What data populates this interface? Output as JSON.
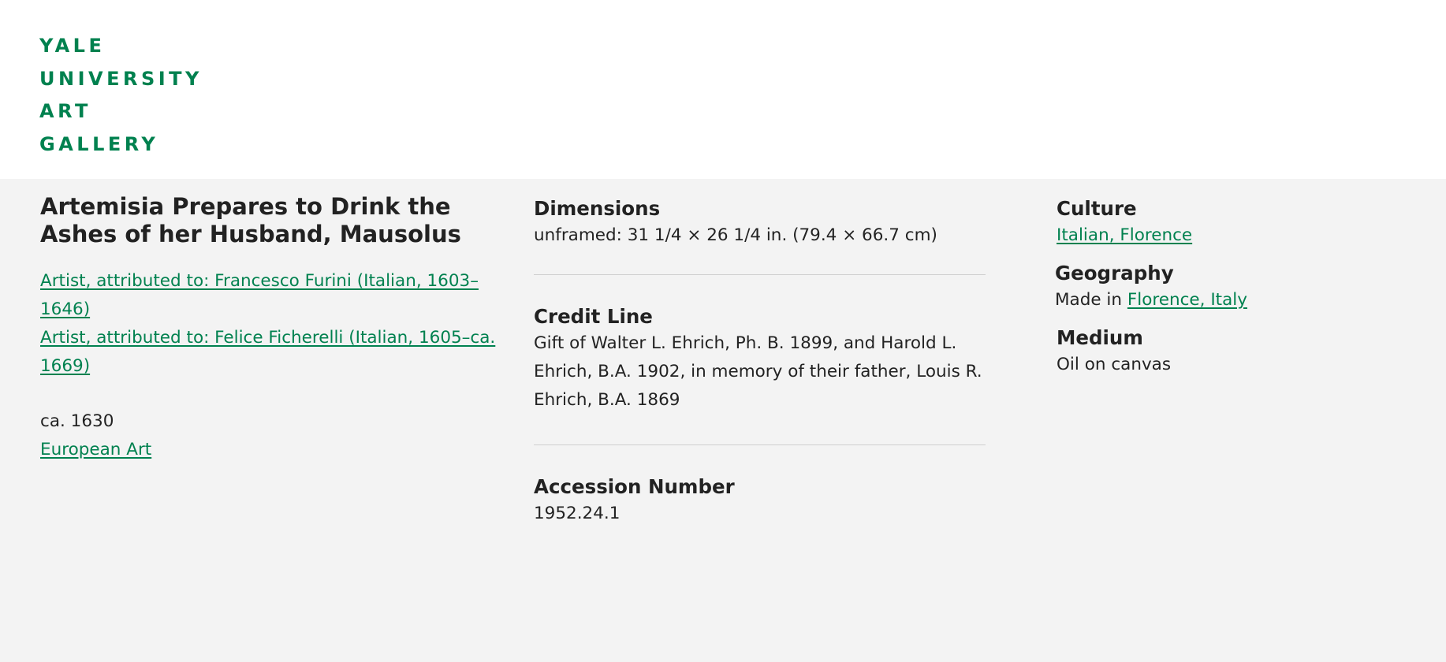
{
  "logo": {
    "lines": [
      "YALE",
      "UNIVERSITY",
      "ART",
      "GALLERY"
    ],
    "color": "#00814f"
  },
  "artwork": {
    "title": "Artemisia Prepares to Drink the Ashes of her Husband, Mausolus",
    "artists": [
      "Artist, attributed to: Francesco Furini (Italian, 1603–1646)",
      "Artist, attributed to: Felice Ficherelli (Italian, 1605–ca. 1669)"
    ],
    "date": "ca. 1630",
    "department": "European Art"
  },
  "details": {
    "dimensions": {
      "label": "Dimensions",
      "value": "unframed: 31 1/4 × 26 1/4 in. (79.4 × 66.7 cm)"
    },
    "credit_line": {
      "label": "Credit Line",
      "value": "Gift of Walter L. Ehrich, Ph. B. 1899, and Harold L. Ehrich, B.A. 1902, in memory of their father, Louis R. Ehrich, B.A. 1869"
    },
    "accession_number": {
      "label": "Accession Number",
      "value": "1952.24.1"
    },
    "culture": {
      "label": "Culture",
      "value": "Italian, Florence"
    },
    "geography": {
      "label": "Geography",
      "prefix": "Made in",
      "place": "Florence, Italy"
    },
    "medium": {
      "label": "Medium",
      "value": "Oil on canvas"
    }
  },
  "colors": {
    "accent": "#00814f",
    "background": "#f3f3f3",
    "header_background": "#ffffff",
    "text": "#222222",
    "divider": "#cfcfcf"
  }
}
